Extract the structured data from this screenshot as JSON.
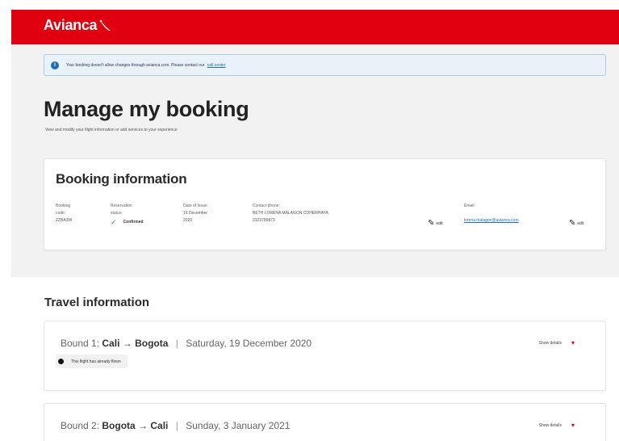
{
  "header": {
    "brand": "Avianca",
    "brand_color": "#e1000f",
    "logo_icon": "bird-logo-icon"
  },
  "notice": {
    "icon": "info-icon",
    "text": "Your booking doesn't allow changes through avianca.com. Please contact our",
    "link": "call center"
  },
  "page": {
    "title": "Manage my booking",
    "subtitle": "View and modify your flight information or add services to your experience"
  },
  "booking": {
    "title": "Booking information",
    "code_label_1": "Booking",
    "code_label_2": "code:",
    "code_value": "ZZBA3W",
    "status_label_1": "Reservation",
    "status_label_2": "status:",
    "status_value": "Confirmed",
    "status_icon": "check-icon",
    "issue_label": "Date of Issue:",
    "issue_value_1": "16 December",
    "issue_value_2": "2020",
    "phone_label": "Contact phone:",
    "phone_value_1": "BETH LORENA MALAGON COHERHAYA",
    "phone_value_2": "3123789873",
    "email_label": "Email:",
    "email_value": "lorena.malagon@avianca.com",
    "edit_label": "edit",
    "edit_icon": "pencil-icon"
  },
  "travel": {
    "title": "Travel information",
    "show_details": "Show details",
    "bounds": [
      {
        "label": "Bound 1:",
        "route": "Cali → Bogota",
        "date": "Saturday, 19 December 2020",
        "badge": "This flight has already flown"
      },
      {
        "label": "Bound 2:",
        "route": "Bogota → Cali",
        "date": "Sunday, 3 January 2021"
      }
    ]
  }
}
